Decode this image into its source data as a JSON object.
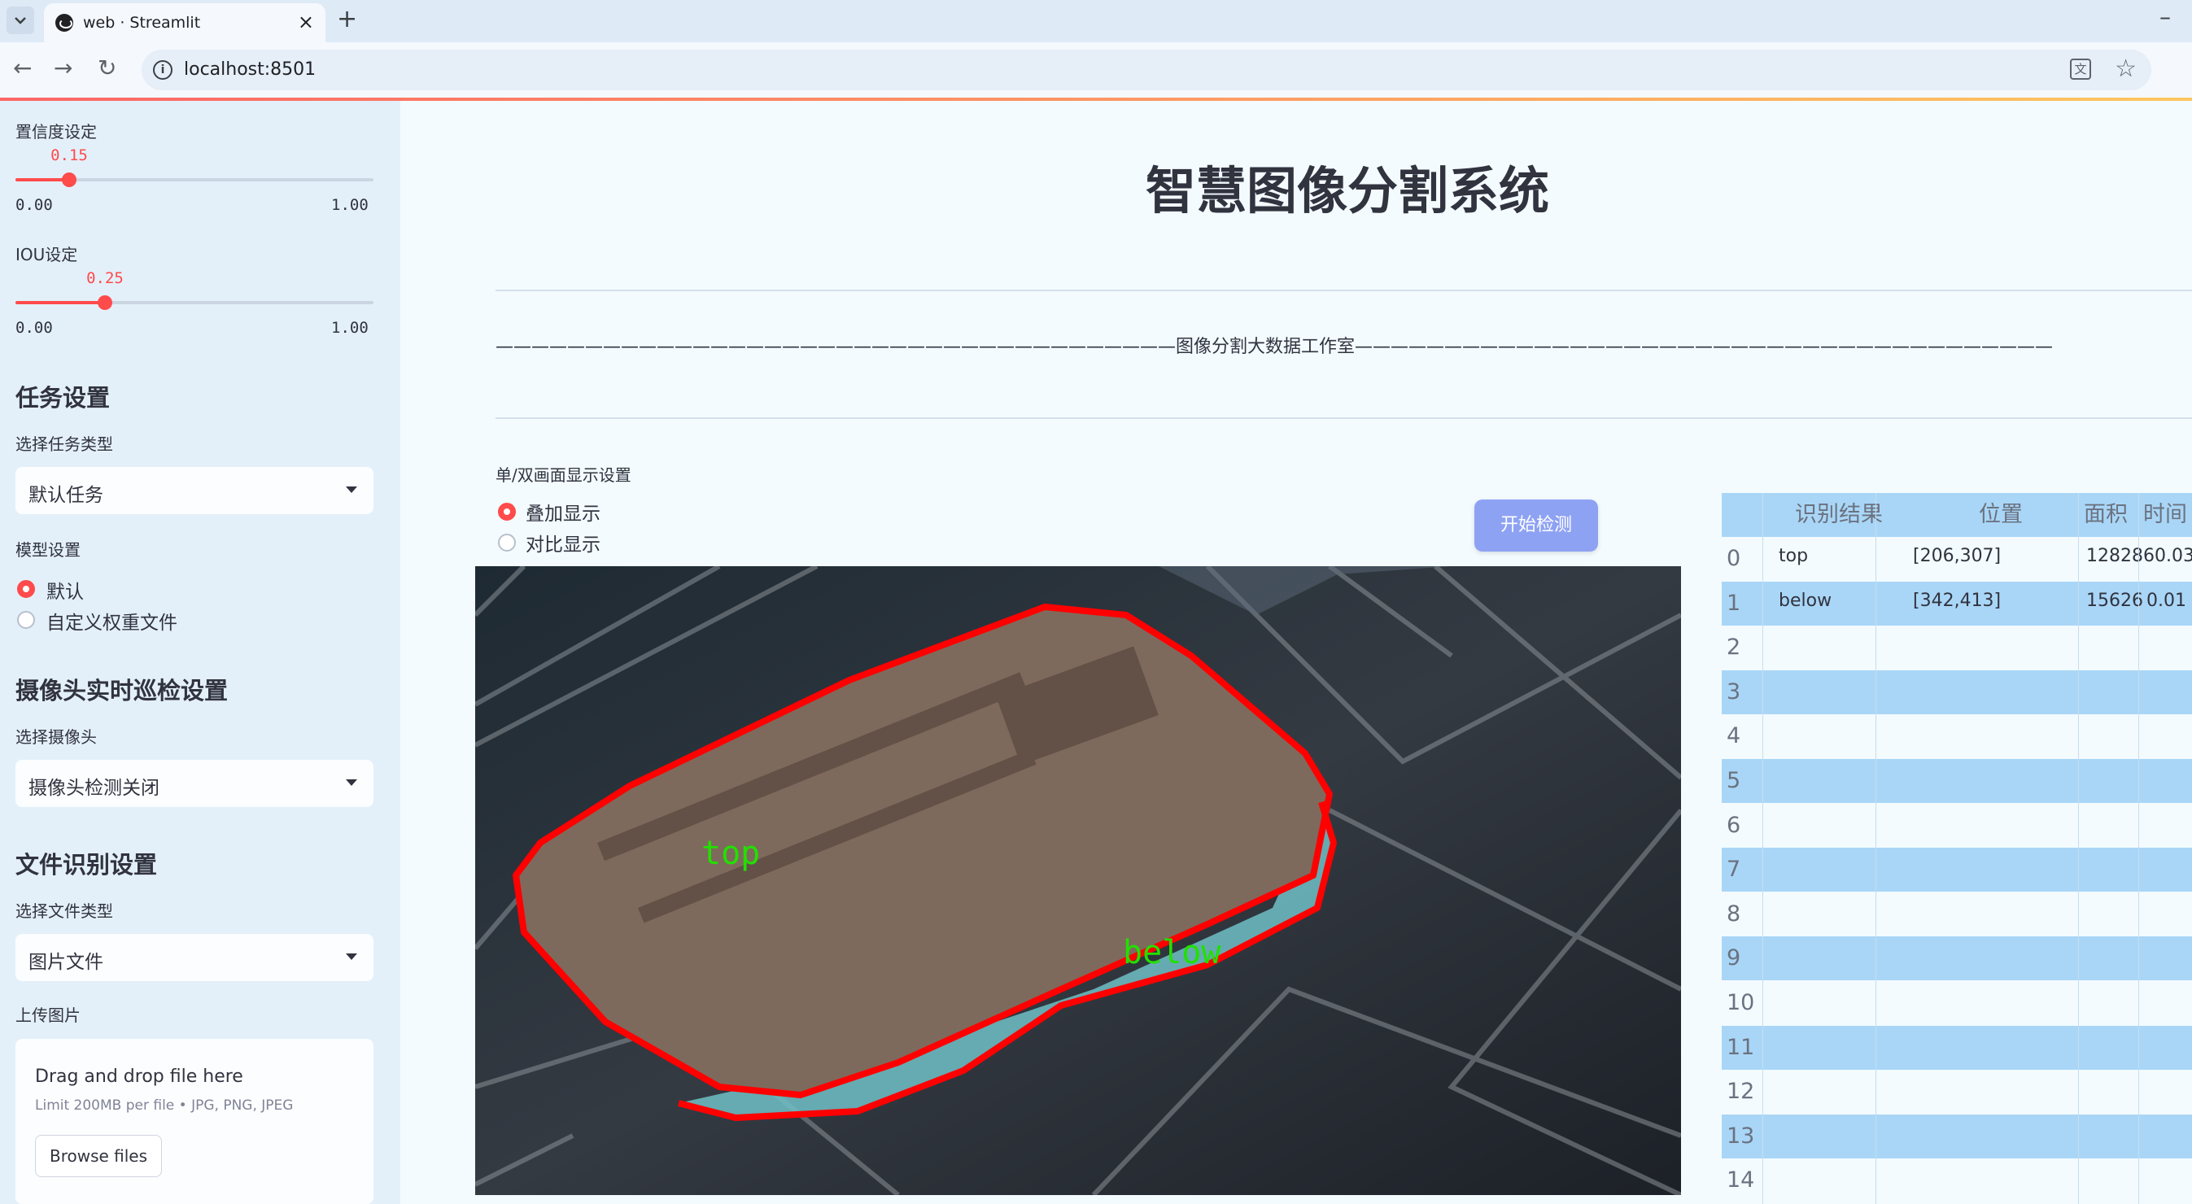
{
  "browser": {
    "tab_title": "web · Streamlit",
    "url": "localhost:8501"
  },
  "sidebar": {
    "confidence": {
      "label": "置信度设定",
      "value": "0.15",
      "min": "0.00",
      "max": "1.00",
      "fraction": 0.15
    },
    "iou": {
      "label": "IOU设定",
      "value": "0.25",
      "min": "0.00",
      "max": "1.00",
      "fraction": 0.25
    },
    "task_header": "任务设置",
    "task_type_label": "选择任务类型",
    "task_type_value": "默认任务",
    "model_label": "模型设置",
    "model_options": [
      "默认",
      "自定义权重文件"
    ],
    "model_selected": 0,
    "camera_header": "摄像头实时巡检设置",
    "camera_label": "选择摄像头",
    "camera_value": "摄像头检测关闭",
    "file_header": "文件识别设置",
    "file_type_label": "选择文件类型",
    "file_type_value": "图片文件",
    "upload_label": "上传图片",
    "uploader": {
      "title": "Drag and drop file here",
      "subtitle": "Limit 200MB per file • JPG, PNG, JPEG",
      "button": "Browse files"
    }
  },
  "main": {
    "title": "智慧图像分割系统",
    "divider_text": "——————————————————————————————————————图像分割大数据工作室———————————————————————————————————————",
    "display_mode_label": "单/双画面显示设置",
    "display_options": [
      "叠加显示",
      "对比显示"
    ],
    "display_selected": 0,
    "start_button": "开始检测",
    "detections": [
      {
        "label": "top",
        "color": "#22e000"
      },
      {
        "label": "below",
        "color": "#22e000"
      }
    ]
  },
  "table": {
    "headers": [
      "",
      "识别结果",
      "位置",
      "面积",
      "时间"
    ],
    "rows": [
      {
        "idx": "0",
        "label": "top",
        "pos": "[206,307]",
        "area": "1282860.03"
      },
      {
        "idx": "1",
        "label": "below",
        "pos": "[342,413]",
        "area": "15626",
        "time": "0.01"
      },
      {
        "idx": "2"
      },
      {
        "idx": "3"
      },
      {
        "idx": "4"
      },
      {
        "idx": "5"
      },
      {
        "idx": "6"
      },
      {
        "idx": "7"
      },
      {
        "idx": "8"
      },
      {
        "idx": "9"
      },
      {
        "idx": "10"
      },
      {
        "idx": "11"
      },
      {
        "idx": "12"
      },
      {
        "idx": "13"
      },
      {
        "idx": "14"
      }
    ]
  },
  "colors": {
    "accent": "#ff4b4b",
    "button": "#8ea2f3",
    "table_stripe": "#a9d6f7",
    "sidebar_bg": "#e3f0fa",
    "mask_outline": "#ff0000"
  }
}
